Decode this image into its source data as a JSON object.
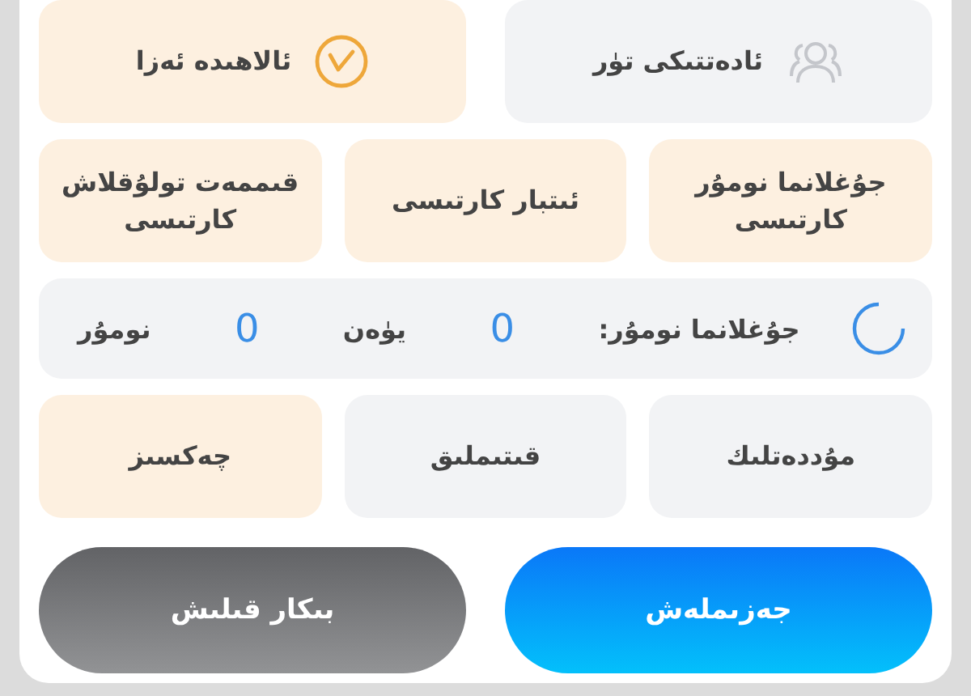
{
  "member_types": [
    {
      "label": "ئادەتتىكى تۈر",
      "kind": "regular",
      "selected": false
    },
    {
      "label": "ئالاھىدە ئەزا",
      "kind": "special",
      "selected": true
    }
  ],
  "cards": [
    {
      "label": "جۇغلانما نومۇر كارتىسى",
      "selected": true
    },
    {
      "label": "ئىتبار كارتىسى",
      "selected": true
    },
    {
      "label": "قىممەت تولۇقلاش كارتىسى",
      "selected": true
    }
  ],
  "points": {
    "label": "جۇغلانما نومۇر:",
    "amount": "0",
    "amount_unit": "يۈەن",
    "points": "0",
    "points_unit": "نومۇر"
  },
  "durations": [
    {
      "label": "مۇددەتلىك",
      "selected": false
    },
    {
      "label": "قىتىملىق",
      "selected": false
    },
    {
      "label": "چەكسىز",
      "selected": true
    }
  ],
  "buttons": [
    {
      "label": "جەزىملەش",
      "kind": "primary"
    },
    {
      "label": "بىكار قىلىش",
      "kind": "secondary"
    }
  ]
}
